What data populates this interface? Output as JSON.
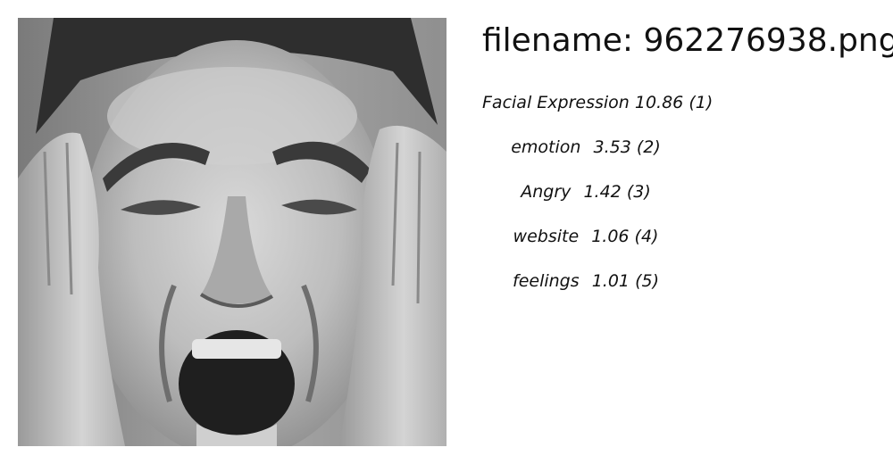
{
  "image": {
    "subject": "face-photo"
  },
  "header": {
    "filename_label": "filename: 962276938.png"
  },
  "tags": [
    {
      "label": "Facial Expression",
      "score": "10.86",
      "rank": "(1)"
    },
    {
      "label": "emotion",
      "score": "3.53",
      "rank": "(2)"
    },
    {
      "label": "Angry",
      "score": "1.42",
      "rank": "(3)"
    },
    {
      "label": "website",
      "score": "1.06",
      "rank": "(4)"
    },
    {
      "label": "feelings",
      "score": "1.01",
      "rank": "(5)"
    }
  ],
  "colors": {
    "background": "#ffffff",
    "text": "#111111"
  }
}
